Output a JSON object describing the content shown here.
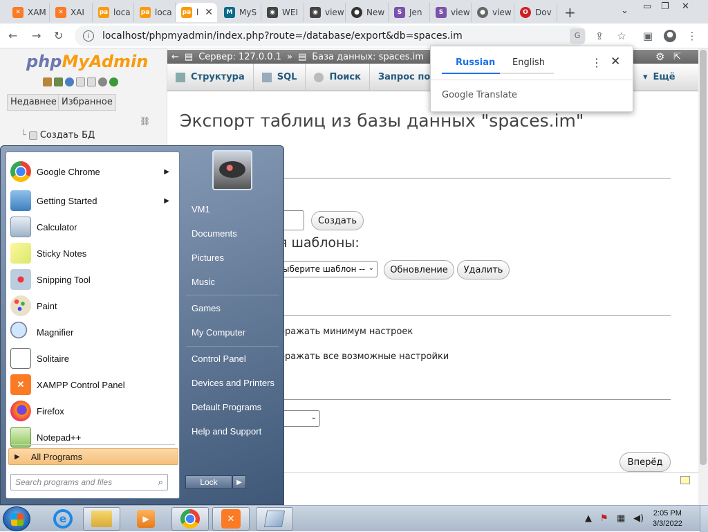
{
  "tabs": [
    {
      "title": "XAM",
      "icon": "xampp-icon",
      "color": "#fb7a24"
    },
    {
      "title": "XAI",
      "icon": "xampp-icon",
      "color": "#fb7a24"
    },
    {
      "title": "loca",
      "icon": "phpmyadmin-icon",
      "color": "#f89c0e"
    },
    {
      "title": "loca",
      "icon": "phpmyadmin-icon",
      "color": "#f89c0e"
    },
    {
      "title": "l",
      "icon": "phpmyadmin-icon",
      "color": "#f89c0e",
      "active": true
    },
    {
      "title": "MyS",
      "icon": "mysql-icon",
      "color": "#0a6b8a"
    },
    {
      "title": "WEI",
      "icon": "eye-icon",
      "color": "#444"
    },
    {
      "title": "view",
      "icon": "eye-icon",
      "color": "#444"
    },
    {
      "title": "New",
      "icon": "github-icon",
      "color": "#333"
    },
    {
      "title": "Jen",
      "icon": "stackoverflow-s-icon",
      "color": "#7b52ab"
    },
    {
      "title": "view",
      "icon": "stackoverflow-s-icon",
      "color": "#7b52ab"
    },
    {
      "title": "view",
      "icon": "globe-icon",
      "color": "#666"
    },
    {
      "title": "Dov",
      "icon": "opera-icon",
      "color": "#cc1f24"
    }
  ],
  "address": {
    "url": "localhost/phpmyadmin/index.php?route=/database/export&db=spaces.im"
  },
  "pma": {
    "logo_a": "php",
    "logo_b": "MyAdmin",
    "recent": "Недавнее",
    "favorites": "Избранное",
    "create_db": "Создать БД",
    "breadcrumb_server": "Сервер: 127.0.0.1",
    "breadcrumb_db": "База данных: spaces.im",
    "menu": [
      "Структура",
      "SQL",
      "Поиск",
      "Запрос по",
      "Ещё"
    ],
    "title": "Экспорт таблиц из базы данных \"spaces.im\"",
    "create_btn": "Создать",
    "templates_heading": "я шаблоны:",
    "template_select": "ыберите шаблон --",
    "update_btn": "Обновление",
    "delete_btn": "Удалить",
    "opt_min": "бражать минимум настроек",
    "opt_all": "бражать все возможные настройки",
    "forward_btn": "Вперёд"
  },
  "translate": {
    "lang_from": "Russian",
    "lang_to": "English",
    "brand": "Google Translate"
  },
  "startmenu": {
    "programs": [
      {
        "label": "Google Chrome",
        "icon": "chrome-icon",
        "arrow": true
      },
      {
        "label": "Getting Started",
        "icon": "getting-started-icon",
        "arrow": true
      },
      {
        "label": "Calculator",
        "icon": "calculator-icon"
      },
      {
        "label": "Sticky Notes",
        "icon": "sticky-notes-icon"
      },
      {
        "label": "Snipping Tool",
        "icon": "snipping-tool-icon"
      },
      {
        "label": "Paint",
        "icon": "paint-icon"
      },
      {
        "label": "Magnifier",
        "icon": "magnifier-icon"
      },
      {
        "label": "Solitaire",
        "icon": "solitaire-icon"
      },
      {
        "label": "XAMPP Control Panel",
        "icon": "xampp-icon"
      },
      {
        "label": "Firefox",
        "icon": "firefox-icon"
      },
      {
        "label": "Notepad++",
        "icon": "notepadpp-icon"
      }
    ],
    "all_programs": "All Programs",
    "search_placeholder": "Search programs and files",
    "right": [
      "VM1",
      "Documents",
      "Pictures",
      "Music",
      "Games",
      "My Computer",
      "Control Panel",
      "Devices and Printers",
      "Default Programs",
      "Help and Support"
    ],
    "lock": "Lock"
  },
  "taskbar": {
    "time": "2:05 PM",
    "date": "3/3/2022"
  }
}
